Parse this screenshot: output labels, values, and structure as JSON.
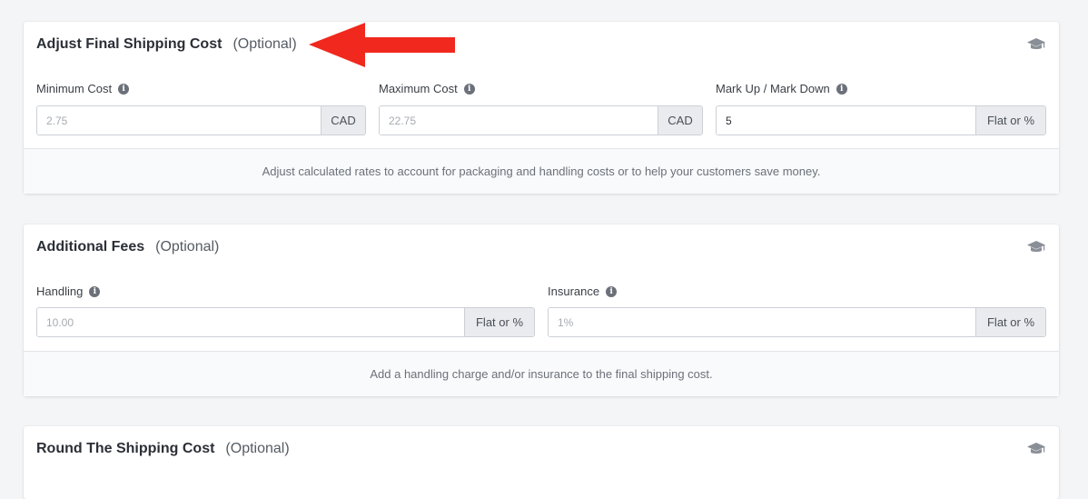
{
  "colors": {
    "accent_arrow": "#f0281e",
    "background": "#f4f5f7"
  },
  "sections": [
    {
      "title": "Adjust Final Shipping Cost",
      "optional": "(Optional)",
      "icon": "graduation-cap-icon",
      "fields": [
        {
          "label": "Minimum Cost",
          "placeholder": "2.75",
          "value": "",
          "addon": "CAD"
        },
        {
          "label": "Maximum Cost",
          "placeholder": "22.75",
          "value": "",
          "addon": "CAD"
        },
        {
          "label": "Mark Up / Mark Down",
          "placeholder": "",
          "value": "5",
          "addon": "Flat or %"
        }
      ],
      "footer": "Adjust calculated rates to account for packaging and handling costs or to help your customers save money."
    },
    {
      "title": "Additional Fees",
      "optional": "(Optional)",
      "icon": "graduation-cap-icon",
      "fields": [
        {
          "label": "Handling",
          "placeholder": "10.00",
          "value": "",
          "addon": "Flat or %"
        },
        {
          "label": "Insurance",
          "placeholder": "1%",
          "value": "",
          "addon": "Flat or %"
        }
      ],
      "footer": "Add a handling charge and/or insurance to the final shipping cost."
    },
    {
      "title": "Round The Shipping Cost",
      "optional": "(Optional)",
      "icon": "graduation-cap-icon"
    }
  ],
  "info_glyph": "i"
}
